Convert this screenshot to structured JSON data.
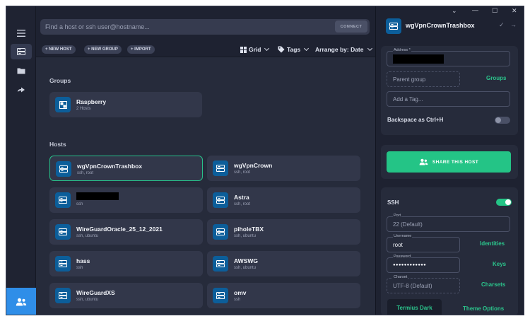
{
  "search": {
    "placeholder": "Find a host or ssh user@hostname...",
    "connect_label": "CONNECT"
  },
  "toolbar": {
    "new_host": "+ NEW HOST",
    "new_group": "+ NEW GROUP",
    "import": "+ IMPORT",
    "grid": "Grid",
    "tags": "Tags",
    "arrange": "Arrange by: Date"
  },
  "groups_title": "Groups",
  "groups": [
    {
      "name": "Raspberry",
      "sub": "2 Hosts"
    }
  ],
  "hosts_title": "Hosts",
  "hosts": [
    {
      "name": "wgVpnCrownTrashbox",
      "sub": "ssh, root",
      "selected": true
    },
    {
      "name": "wgVpnCrown",
      "sub": "ssh, root"
    },
    {
      "name": "",
      "sub": "ssh",
      "redacted": true
    },
    {
      "name": "Astra",
      "sub": "ssh, root"
    },
    {
      "name": "WireGuardOracle_25_12_2021",
      "sub": "ssh, ubuntu"
    },
    {
      "name": "piholeTBX",
      "sub": "ssh, ubuntu"
    },
    {
      "name": "hass",
      "sub": "ssh"
    },
    {
      "name": "AWSWG",
      "sub": "ssh, ubuntu"
    },
    {
      "name": "WireGuardXS",
      "sub": "ssh, ubuntu"
    },
    {
      "name": "omv",
      "sub": "ssh"
    }
  ],
  "panel": {
    "title": "wgVpnCrownTrashbox",
    "address_label": "Address *",
    "parent_group_placeholder": "Parent group",
    "groups_link": "Groups",
    "tag_placeholder": "Add a Tag...",
    "backspace_label": "Backspace as Ctrl+H",
    "backspace_on": false,
    "share_label": "SHARE THIS HOST",
    "ssh_label": "SSH",
    "ssh_on": true,
    "port_label": "Port",
    "port_value": "22 (Default)",
    "username_label": "Username",
    "username_value": "root",
    "identities_link": "Identities",
    "password_label": "Password",
    "password_value": "●●●●●●●●●●●●",
    "keys_link": "Keys",
    "charset_label": "Charset",
    "charset_value": "UTF-8 (Default)",
    "charsets_link": "Charsets",
    "theme_value": "Termius Dark",
    "theme_options_link": "Theme Options"
  },
  "colors": {
    "accent_green": "#24c486",
    "brand_blue": "#0c5e9a",
    "rail_blue": "#2f8ee8"
  }
}
